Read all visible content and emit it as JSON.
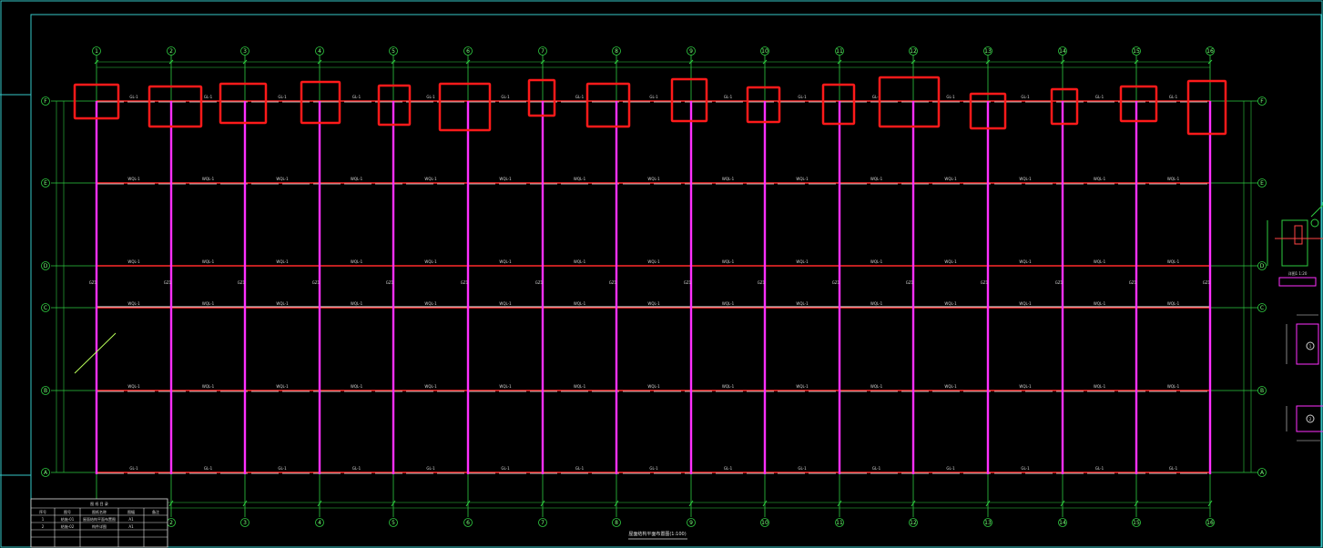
{
  "colors": {
    "background": "#000000",
    "grid": "#2ecc40",
    "border": "#36c7c7",
    "column": "#ff30ff",
    "beam_red": "#ff2a2a",
    "beam_white": "#f0f0f0",
    "highlight": "#ff1a1a"
  },
  "plan": {
    "column_axes": [
      "1",
      "2",
      "3",
      "4",
      "5",
      "6",
      "7",
      "8",
      "9",
      "10",
      "11",
      "12",
      "13",
      "14",
      "15",
      "16"
    ],
    "row_axes": [
      "F",
      "E",
      "D",
      "C",
      "B",
      "A"
    ],
    "top_beam_label": "GL-1",
    "mid_beam_label": "WQL-1",
    "column_label": "GZ1",
    "drawing_title": "屋面结构平面布置图(1:100)"
  },
  "title_block": {
    "header": "图 纸 目 录",
    "columns": [
      "序号",
      "图号",
      "图纸名称",
      "图幅",
      "备注"
    ],
    "rows": [
      [
        "1",
        "结施-01",
        "屋面结构平面布置图",
        "A1",
        ""
      ],
      [
        "2",
        "结施-02",
        "构件详图",
        "A1",
        ""
      ]
    ]
  },
  "details": {
    "detail1_caption": "详图1 1:20",
    "detail2_marker": "1",
    "detail3_marker": "2"
  }
}
